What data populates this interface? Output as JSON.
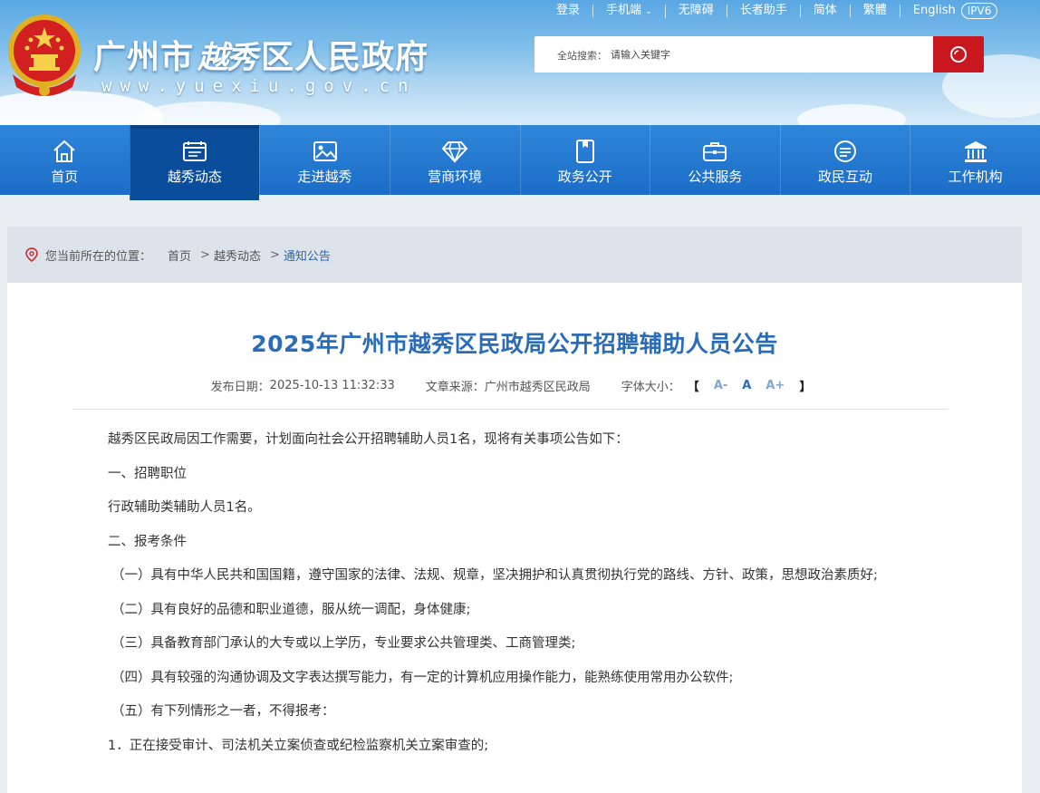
{
  "header": {
    "site_title_prefix": "广州市",
    "site_title_calligraphy": "越秀",
    "site_title_suffix": "区人民政府",
    "site_url": "www.yuexiu.gov.cn",
    "top_links": [
      "登录",
      "手机端",
      "无障碍",
      "长者助手",
      "简体",
      "繁體",
      "English"
    ],
    "ipv6_badge": "IPV6",
    "search": {
      "label": "全站搜索：",
      "placeholder": "请输入关键字",
      "button_icon": "search-icon"
    }
  },
  "nav": {
    "items": [
      {
        "label": "首页",
        "icon": "home-icon"
      },
      {
        "label": "越秀动态",
        "icon": "news-icon",
        "active": true
      },
      {
        "label": "走进越秀",
        "icon": "picture-icon"
      },
      {
        "label": "营商环境",
        "icon": "diamond-icon"
      },
      {
        "label": "政务公开",
        "icon": "file-icon"
      },
      {
        "label": "公共服务",
        "icon": "briefcase-icon"
      },
      {
        "label": "政民互动",
        "icon": "chat-icon"
      },
      {
        "label": "工作机构",
        "icon": "building-icon"
      }
    ]
  },
  "breadcrumb": {
    "prefix": "您当前所在的位置：",
    "items": [
      "首页",
      "越秀动态",
      "通知公告"
    ]
  },
  "article": {
    "title": "2025年广州市越秀区民政局公开招聘辅助人员公告",
    "date_label": "发布日期：",
    "date": "2025-10-13 11:32:33",
    "source_label": "文章来源：",
    "source": "广州市越秀区民政局",
    "font_size_label": "字体大小：",
    "bracket_open": "【",
    "bracket_close": "】",
    "font_small": "A-",
    "font_mid": "A",
    "font_large": "A+",
    "paragraphs": [
      "越秀区民政局因工作需要，计划面向社会公开招聘辅助人员1名，现将有关事项公告如下：",
      "一、招聘职位",
      "行政辅助类辅助人员1名。",
      "二、报考条件",
      "（一）具有中华人民共和国国籍，遵守国家的法律、法规、规章，坚决拥护和认真贯彻执行党的路线、方针、政策，思想政治素质好;",
      "（二）具有良好的品德和职业道德，服从统一调配，身体健康;",
      "（三）具备教育部门承认的大专或以上学历，专业要求公共管理类、工商管理类;",
      "（四）具有较强的沟通协调及文字表达撰写能力，有一定的计算机应用操作能力，能熟练使用常用办公软件;",
      "（五）有下列情形之一者，不得报考：",
      "1．正在接受审计、司法机关立案侦查或纪检监察机关立案审查的;"
    ]
  },
  "colors": {
    "nav_bg": "#1b6cc7",
    "nav_active": "#0a4d9b",
    "title_blue": "#2a6cb8",
    "search_red": "#c8171e"
  }
}
